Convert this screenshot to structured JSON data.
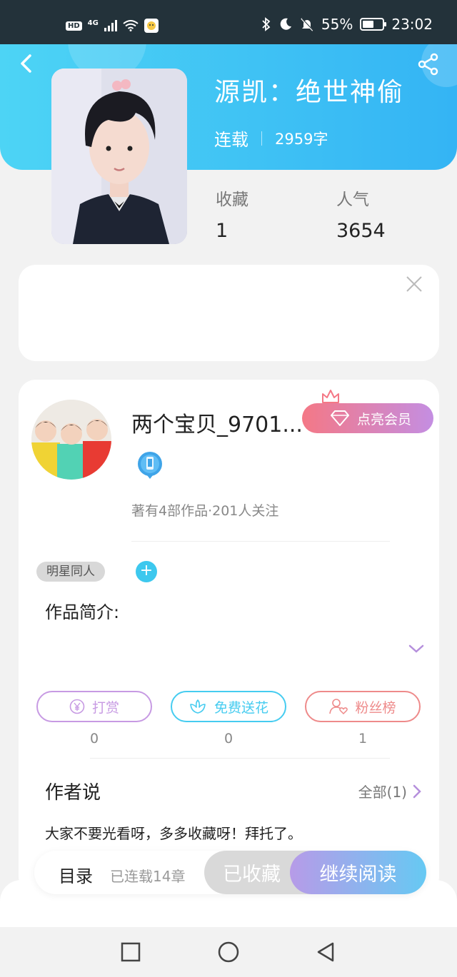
{
  "status_bar": {
    "hd": "HD",
    "network": "4G",
    "battery_text": "55%",
    "battery_level": 0.55,
    "time": "23:02"
  },
  "book": {
    "title": "源凯：绝世神偷",
    "status": "连载",
    "word_count": "2959字",
    "favorites_label": "收藏",
    "favorites_value": "1",
    "popularity_label": "人气",
    "popularity_value": "3654"
  },
  "author": {
    "name": "两个宝贝_9701...",
    "vip_label": "点亮会员",
    "stats": "著有4部作品·201人关注"
  },
  "tags": {
    "tag": "明星同人",
    "add": "+"
  },
  "intro": {
    "label": "作品简介:"
  },
  "actions": [
    {
      "label": "打赏",
      "count": "0",
      "color": "#c79ae3"
    },
    {
      "label": "免费送花",
      "count": "0",
      "color": "#46ccf0"
    },
    {
      "label": "粉丝榜",
      "count": "1",
      "color": "#ee8a8a"
    }
  ],
  "author_says": {
    "title": "作者说",
    "all": "全部(1)",
    "text": "大家不要光看呀，多多收藏呀！拜托了。"
  },
  "bottom_bar": {
    "toc": "目录",
    "chapters": "已连载14章",
    "favorited": "已收藏",
    "continue": "继续阅读"
  },
  "icons": {
    "back": "back-arrow-icon",
    "share": "share-icon",
    "close": "close-icon",
    "crown": "crown-icon",
    "diamond": "diamond-icon",
    "badge": "phone-badge-icon",
    "expand": "chevron-down-icon",
    "yen": "yen-coin-icon",
    "flower": "flower-icon",
    "fan": "person-heart-icon",
    "arrow": "chevron-right-icon"
  },
  "colors": {
    "header_start": "#4dd4f5",
    "header_end": "#34b4f4",
    "vip_start": "#f47886",
    "vip_end": "#c48ee2",
    "read_start": "#b79be8",
    "read_end": "#66c9f3",
    "accent_purple": "#b58fdc"
  }
}
